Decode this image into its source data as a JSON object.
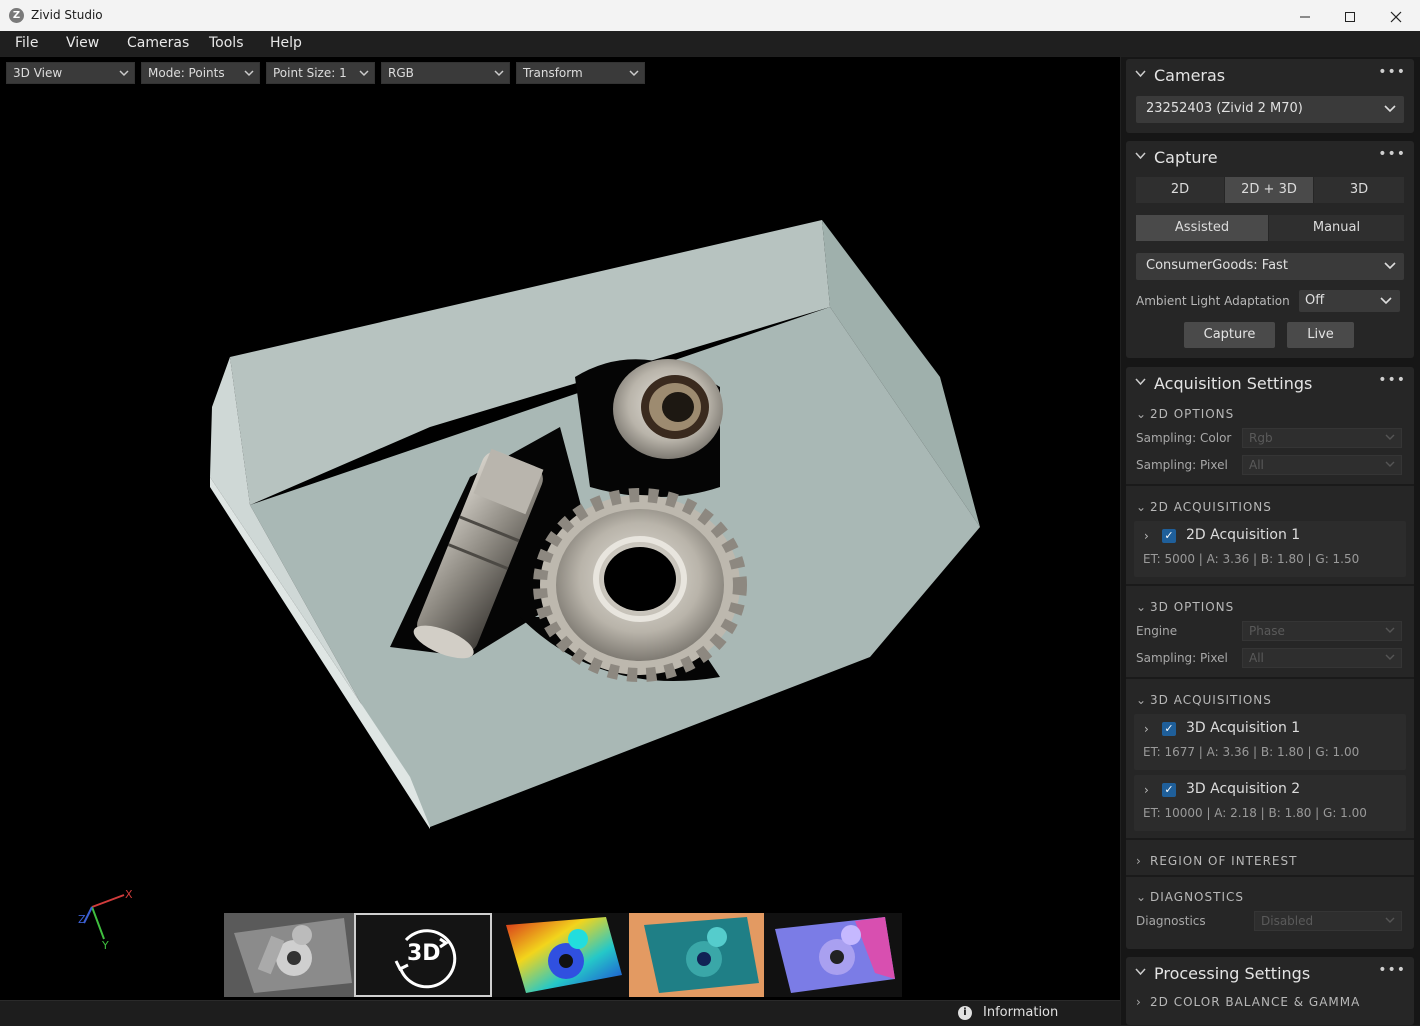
{
  "window": {
    "title": "Zivid Studio",
    "logo_letter": "Z"
  },
  "menu": [
    "File",
    "View",
    "Cameras",
    "Tools",
    "Help"
  ],
  "toolbar": {
    "view": "3D View",
    "mode": "Mode: Points",
    "point_size": "Point Size: 1",
    "color": "RGB",
    "transform": "Transform"
  },
  "axes": {
    "x": "X",
    "y": "Y",
    "z": "Z"
  },
  "thumbnail_3d_label": "3D",
  "status": {
    "info_label": "Information"
  },
  "cameras": {
    "title": "Cameras",
    "selected": "23252403 (Zivid 2 M70)"
  },
  "capture": {
    "title": "Capture",
    "modes": [
      "2D",
      "2D + 3D",
      "3D"
    ],
    "active_mode": "2D + 3D",
    "settings_modes": [
      "Assisted",
      "Manual"
    ],
    "active_settings_mode": "Assisted",
    "preset": "ConsumerGoods: Fast",
    "ambient_label": "Ambient Light Adaptation",
    "ambient_value": "Off",
    "capture_button": "Capture",
    "live_button": "Live"
  },
  "acquisition": {
    "title": "Acquisition Settings",
    "options_2d": {
      "title": "2D OPTIONS",
      "color_label": "Sampling: Color",
      "color_value": "Rgb",
      "pixel_label": "Sampling: Pixel",
      "pixel_value": "All"
    },
    "acquisitions_2d": {
      "title": "2D ACQUISITIONS",
      "items": [
        {
          "name": "2D Acquisition 1",
          "params": "ET: 5000  |  A: 3.36  |  B: 1.80  |  G: 1.50"
        }
      ]
    },
    "options_3d": {
      "title": "3D OPTIONS",
      "engine_label": "Engine",
      "engine_value": "Phase",
      "pixel_label": "Sampling: Pixel",
      "pixel_value": "All"
    },
    "acquisitions_3d": {
      "title": "3D ACQUISITIONS",
      "items": [
        {
          "name": "3D Acquisition 1",
          "params": "ET: 1677  |  A: 3.36  |  B: 1.80  |  G: 1.00"
        },
        {
          "name": "3D Acquisition 2",
          "params": "ET: 10000  |  A: 2.18  |  B: 1.80  |  G: 1.00"
        }
      ]
    },
    "roi": {
      "title": "REGION OF INTEREST"
    },
    "diagnostics": {
      "title": "DIAGNOSTICS",
      "label": "Diagnostics",
      "value": "Disabled"
    }
  },
  "processing": {
    "title": "Processing Settings",
    "sub": "2D COLOR BALANCE & GAMMA"
  }
}
